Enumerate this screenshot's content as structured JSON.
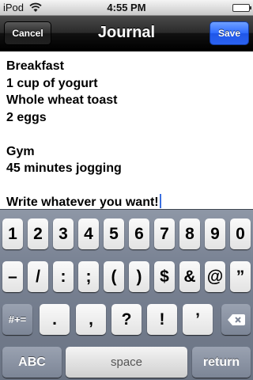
{
  "status": {
    "carrier": "iPod",
    "time": "4:55 PM",
    "battery_level": 1.0
  },
  "nav": {
    "title": "Journal",
    "cancel_label": "Cancel",
    "save_label": "Save",
    "save_color": "#2e6bff"
  },
  "note": {
    "lines": [
      "Breakfast",
      "1 cup of yogurt",
      "Whole wheat toast",
      "2 eggs",
      "",
      "Gym",
      "45 minutes jogging",
      "",
      "Write whatever you want!"
    ]
  },
  "keyboard": {
    "row1": [
      "1",
      "2",
      "3",
      "4",
      "5",
      "6",
      "7",
      "8",
      "9",
      "0"
    ],
    "row2": [
      "–",
      "/",
      ":",
      ";",
      "(",
      ")",
      "$",
      "&",
      "@",
      "”"
    ],
    "row3": [
      ".",
      ",",
      "?",
      "!",
      "’"
    ],
    "symbols_label": "#+=",
    "abc_label": "ABC",
    "space_label": "space",
    "return_label": "return",
    "icons": {
      "backspace": "backspace-icon",
      "wifi": "wifi-icon",
      "battery": "battery-icon"
    }
  }
}
